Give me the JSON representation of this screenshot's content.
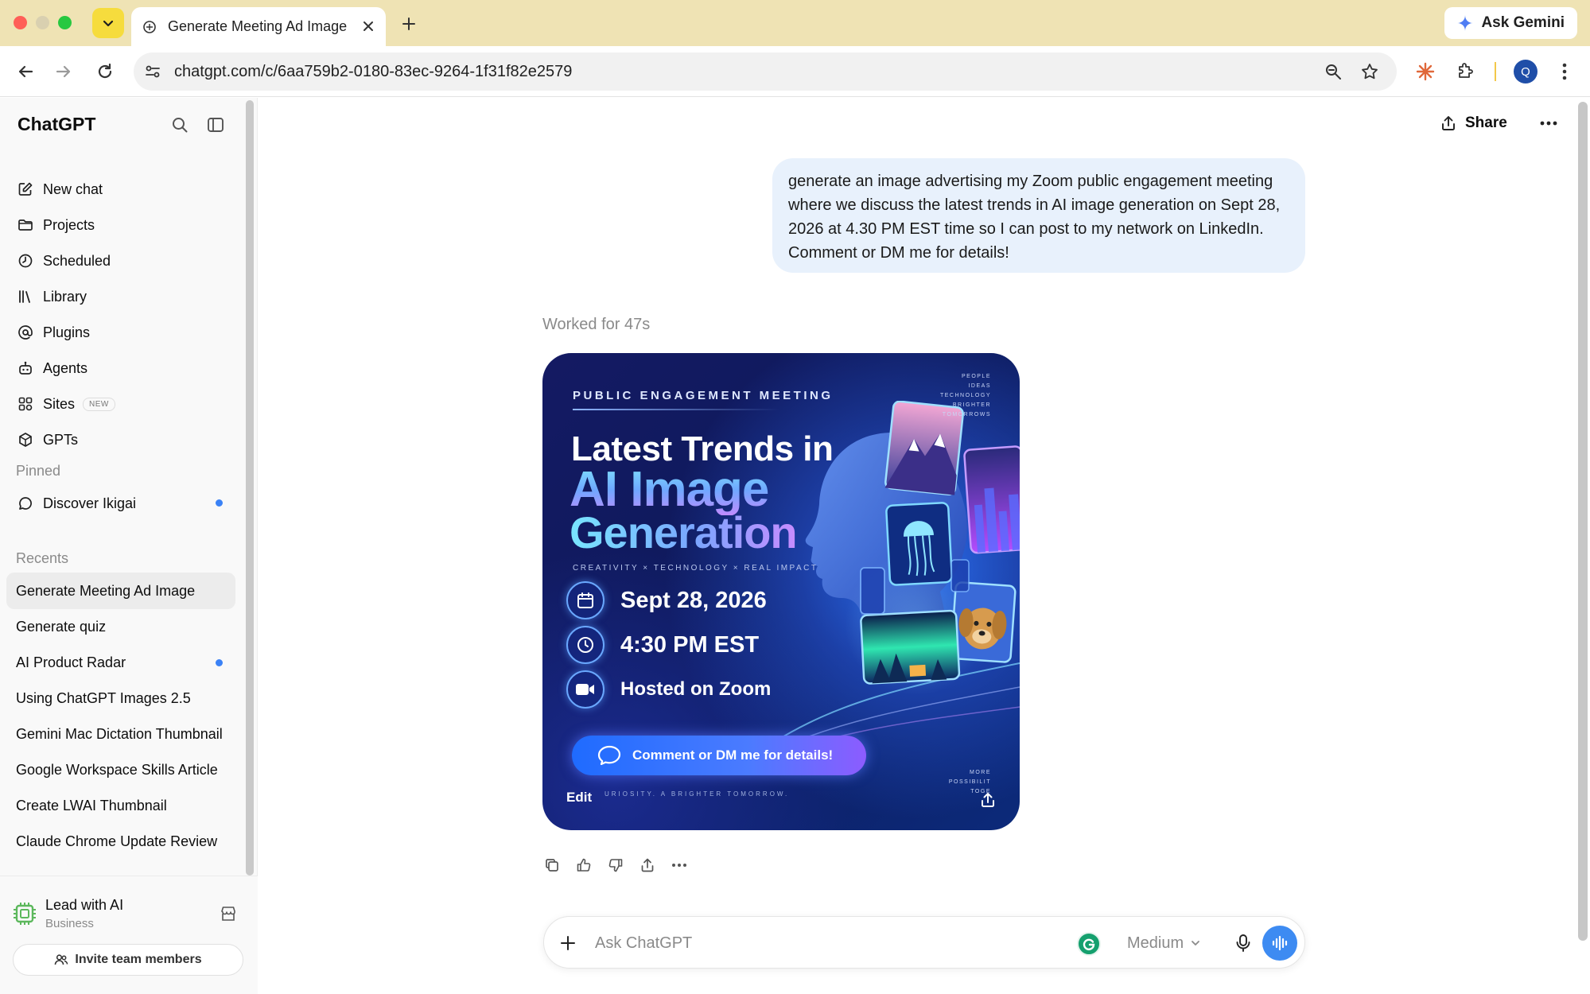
{
  "browser": {
    "tab_title": "Generate Meeting Ad Image",
    "ask_gemini": "Ask Gemini",
    "url": "chatgpt.com/c/6aa759b2-0180-83ec-9264-1f31f82e2579",
    "profile_initial": "Q"
  },
  "sidebar": {
    "brand": "ChatGPT",
    "nav": [
      {
        "label": "New chat",
        "icon": "edit-icon"
      },
      {
        "label": "Projects",
        "icon": "folder-icon"
      },
      {
        "label": "Scheduled",
        "icon": "clock-icon"
      },
      {
        "label": "Library",
        "icon": "library-icon"
      },
      {
        "label": "Plugins",
        "icon": "at-icon"
      },
      {
        "label": "Agents",
        "icon": "robot-icon"
      },
      {
        "label": "Sites",
        "icon": "sites-icon",
        "badge": "NEW"
      },
      {
        "label": "GPTs",
        "icon": "cube-icon"
      }
    ],
    "pinned_label": "Pinned",
    "pinned": [
      {
        "label": "Discover Ikigai",
        "unread": true
      }
    ],
    "recents_label": "Recents",
    "recents": [
      {
        "label": "Generate Meeting Ad Image",
        "active": true
      },
      {
        "label": "Generate quiz"
      },
      {
        "label": "AI Product Radar",
        "unread": true
      },
      {
        "label": "Using ChatGPT Images 2.5"
      },
      {
        "label": "Gemini Mac Dictation Thumbnail"
      },
      {
        "label": "Google Workspace Skills Article"
      },
      {
        "label": "Create LWAI Thumbnail"
      },
      {
        "label": "Claude Chrome Update Review"
      }
    ],
    "workspace": {
      "name": "Lead with AI",
      "plan": "Business"
    },
    "invite_label": "Invite team members"
  },
  "header": {
    "share_label": "Share"
  },
  "conversation": {
    "user_message": "generate an image advertising my Zoom public engagement meeting where we discuss the latest trends in AI image generation on Sept 28, 2026 at 4.30 PM EST time so I can post to my network on LinkedIn. Comment or DM me for details!",
    "worked_for": "Worked for 47s",
    "image": {
      "kicker": "PUBLIC ENGAGEMENT MEETING",
      "headline_1": "Latest Trends in",
      "headline_2": "AI Image",
      "headline_3": "Generation",
      "tagline": "CREATIVITY  ×  TECHNOLOGY  ×  REAL IMPACT",
      "date": "Sept 28, 2026",
      "time": "4:30 PM EST",
      "host": "Hosted on Zoom",
      "cta": "Comment or DM me for details!",
      "side_text": [
        "PEOPLE",
        "IDEAS",
        "TECHNOLOGY",
        "BRIGHTER",
        "TOMORROWS"
      ],
      "side_text_bottom": [
        "MORE",
        "POSSIBILIT",
        "TOGE"
      ],
      "footnote": "URIOSITY.  A BRIGHTER TOMORROW.",
      "edit_label": "Edit"
    }
  },
  "composer": {
    "placeholder": "Ask ChatGPT",
    "model": "Medium"
  },
  "colors": {
    "accent_blue": "#3d8bf2",
    "unread_dot": "#3b82f6",
    "user_bubble": "#e8f1fc",
    "tabbar": "#efe3b4"
  }
}
